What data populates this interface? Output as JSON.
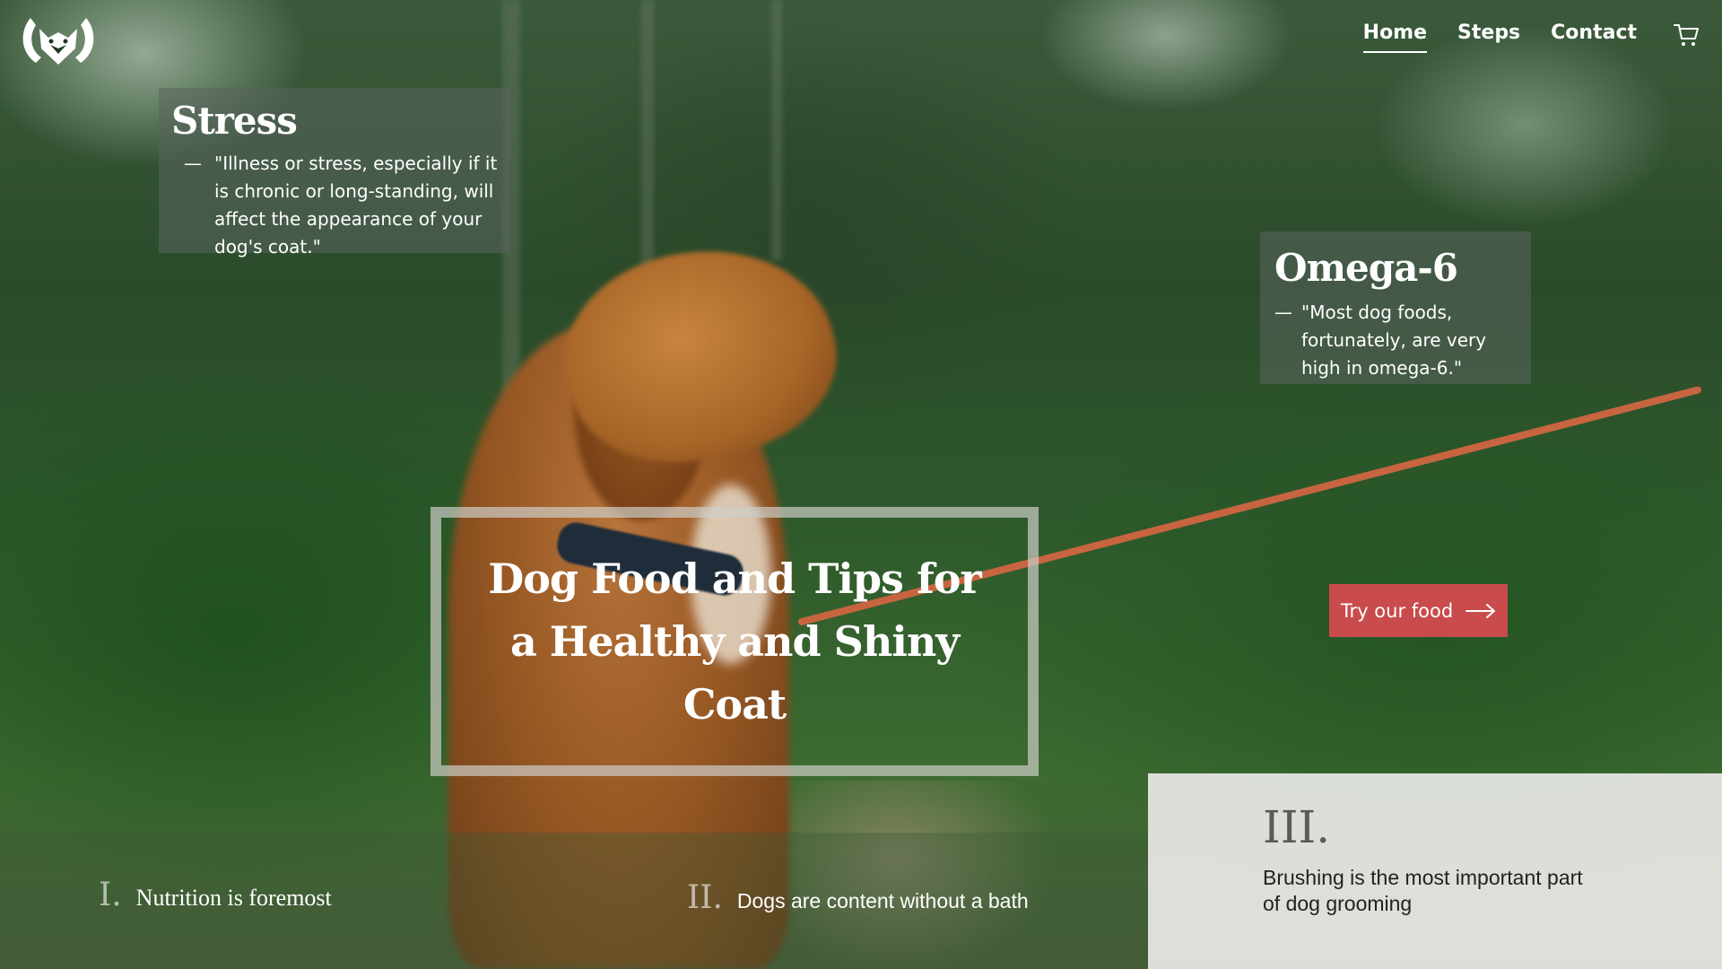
{
  "nav": {
    "logo_icon": "wolf-head-logo-icon",
    "links": [
      {
        "label": "Home",
        "active": true
      },
      {
        "label": "Steps",
        "active": false
      },
      {
        "label": "Contact",
        "active": false
      }
    ],
    "cart_icon": "shopping-cart-icon"
  },
  "cards": {
    "stress": {
      "title": "Stress",
      "dash": "—",
      "quote": "\"Illness or stress, especially if it is chronic or long-standing, will affect the appearance of your dog's coat.\""
    },
    "omega": {
      "title": "Omega-6",
      "dash": "—",
      "quote": "\"Most dog foods, fortunately, are very high in omega-6.\""
    }
  },
  "hero": {
    "title": "Dog Food and Tips for a Healthy and Shiny Coat"
  },
  "cta": {
    "label": "Try our food",
    "icon": "arrow-right-icon",
    "color": "#c94b4b"
  },
  "steps": [
    {
      "num": "I.",
      "text": "Nutrition is foremost"
    },
    {
      "num": "II.",
      "text": "Dogs are content without a bath"
    },
    {
      "num": "III.",
      "text": "Brushing is the most important part of dog grooming"
    }
  ]
}
